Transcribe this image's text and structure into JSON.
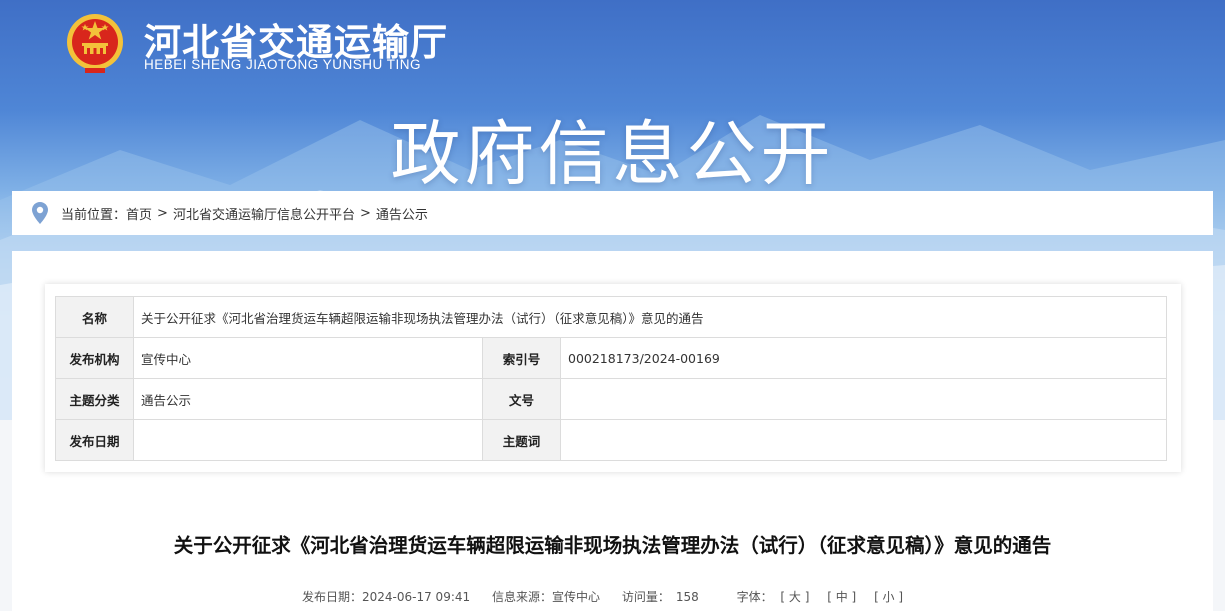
{
  "header": {
    "site_name": "河北省交通运输厅",
    "site_pinyin": "HEBEI SHENG JIAOTONG YUNSHU TING",
    "page_heading": "政府信息公开"
  },
  "breadcrumb": {
    "prefix": "当前位置：",
    "items": [
      "首页",
      "河北省交通运输厅信息公开平台",
      "通告公示"
    ],
    "separator": ">"
  },
  "meta_table": {
    "name_label": "名称",
    "name_value": "关于公开征求《河北省治理货运车辆超限运输非现场执法管理办法（试行）（征求意见稿）》意见的通告",
    "publisher_label": "发布机构",
    "publisher_value": "宣传中心",
    "index_label": "索引号",
    "index_value": "000218173/2024-00169",
    "category_label": "主题分类",
    "category_value": "通告公示",
    "doc_no_label": "文号",
    "doc_no_value": "",
    "date_label": "发布日期",
    "date_value": "",
    "keyword_label": "主题词",
    "keyword_value": ""
  },
  "article": {
    "title": "关于公开征求《河北省治理货运车辆超限运输非现场执法管理办法（试行）（征求意见稿）》意见的通告",
    "publish_date": "发布日期：2024-06-17 09:41",
    "source": "信息来源：宣传中心",
    "views_label": "访问量：",
    "views_value": "158",
    "font_label": "字体：",
    "font_large": "[ 大 ]",
    "font_medium": "[ 中 ]",
    "font_small": "[ 小 ]"
  },
  "colors": {
    "banner_top": "#3f6fc6",
    "emblem_red": "#d8261c",
    "emblem_gold": "#f3c23a",
    "pin_blue": "#7da2d3"
  }
}
